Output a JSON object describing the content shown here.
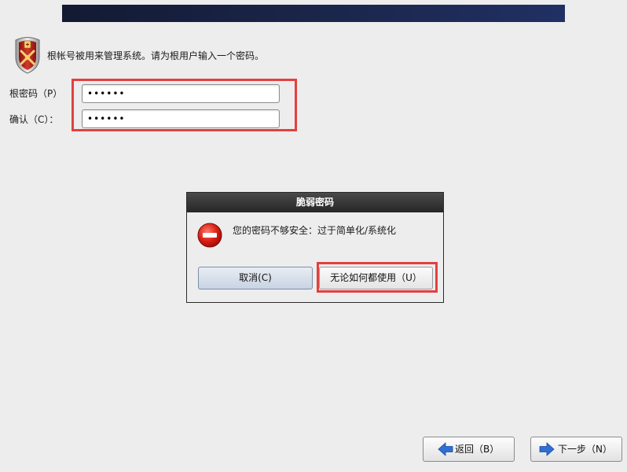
{
  "intro": {
    "text": "根帐号被用来管理系统。请为根用户输入一个密码。",
    "icon": "root-shield-icon"
  },
  "fields": {
    "root_password": {
      "label": "根密码（P）",
      "value": "••••••"
    },
    "confirm": {
      "label": "确认（C）：",
      "value": "••••••"
    }
  },
  "dialog": {
    "title": "脆弱密码",
    "message": "您的密码不够安全：过于简单化/系统化",
    "icon": "error-icon",
    "cancel_label": "取消(C)",
    "use_anyway_label": "无论如何都使用（U）"
  },
  "nav": {
    "back_label": "返回（B）",
    "next_label": "下一步（N）",
    "back_icon": "arrow-left-icon",
    "next_icon": "arrow-right-icon"
  },
  "colors": {
    "highlight": "#e34040",
    "banner": "#1a2447",
    "arrow": "#2f6fd6"
  }
}
